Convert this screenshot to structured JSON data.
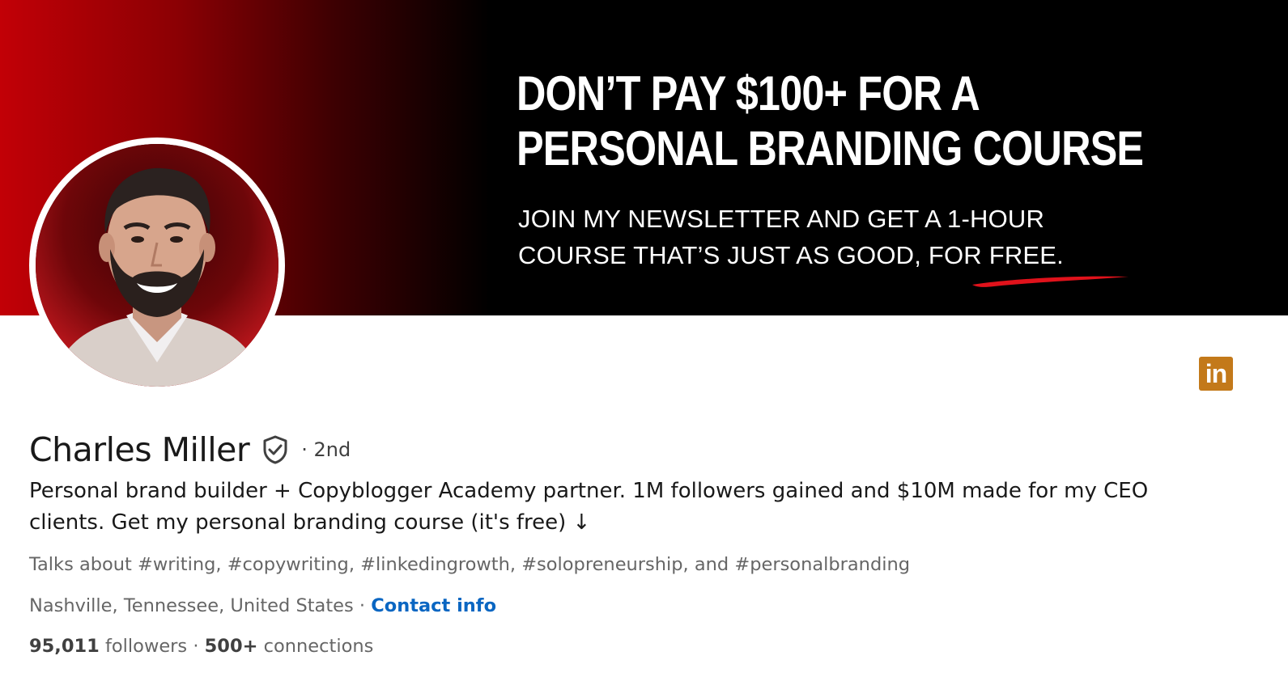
{
  "banner": {
    "headline_lines": [
      "DON’T PAY $100+ FOR A",
      "PERSONAL BRANDING COURSE"
    ],
    "sub_lines": [
      "JOIN MY NEWSLETTER AND GET A 1-HOUR",
      "COURSE THAT’S JUST AS GOOD, FOR FREE."
    ],
    "colors": {
      "gradient_start": "#c20006",
      "background": "#000000",
      "swoosh": "#e0121b"
    }
  },
  "profile": {
    "name": "Charles Miller",
    "verified_icon": "shield-check-icon",
    "degree": "· 2nd",
    "headline_lines": [
      "Personal brand builder + Copyblogger Academy partner. 1M followers gained and $10M made for my CEO",
      "clients. Get my personal branding course (it's free) ↓"
    ],
    "talks_about": "Talks about #writing, #copywriting, #linkedingrowth, #solopreneurship, and #personalbranding",
    "location": "Nashville, Tennessee, United States",
    "location_separator": " · ",
    "contact_info": "Contact info",
    "followers_count": "95,011",
    "followers_label": "followers",
    "stats_separator": " · ",
    "connections_count": "500+",
    "connections_label": "connections"
  },
  "badge": {
    "icon": "linkedin-icon",
    "text": "in",
    "color": "#c3791a"
  },
  "colors": {
    "link": "#0a66c2",
    "text_primary": "#191919",
    "text_secondary": "#666666"
  }
}
